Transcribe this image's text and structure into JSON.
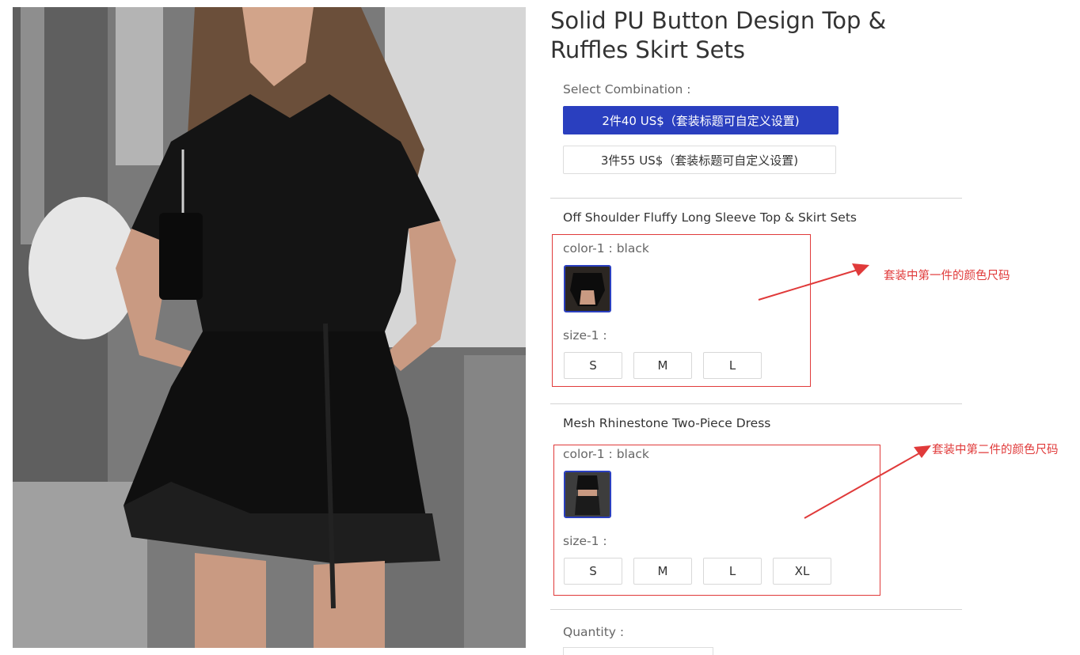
{
  "product": {
    "title": "Solid PU Button Design Top & Ruffles Skirt Sets"
  },
  "combination": {
    "label": "Select Combination :",
    "options": [
      {
        "label": "2件40 US$（套装标题可自定义设置)",
        "selected": true
      },
      {
        "label": "3件55 US$（套装标题可自定义设置)",
        "selected": false
      }
    ]
  },
  "items": [
    {
      "name": "Off Shoulder Fluffy Long Sleeve Top & Skirt Sets",
      "color_label": "color-1 : black",
      "size_label": "size-1 :",
      "sizes": [
        "S",
        "M",
        "L"
      ],
      "annotation": "套装中第一件的颜色尺码"
    },
    {
      "name": "Mesh Rhinestone Two-Piece Dress",
      "color_label": "color-1 : black",
      "size_label": "size-1 :",
      "sizes": [
        "S",
        "M",
        "L",
        "XL"
      ],
      "annotation": "套装中第二件的颜色尺码"
    }
  ],
  "quantity": {
    "label": "Quantity :"
  },
  "colors": {
    "accent": "#2a3fbf",
    "annotation_red": "#e03a3a"
  }
}
